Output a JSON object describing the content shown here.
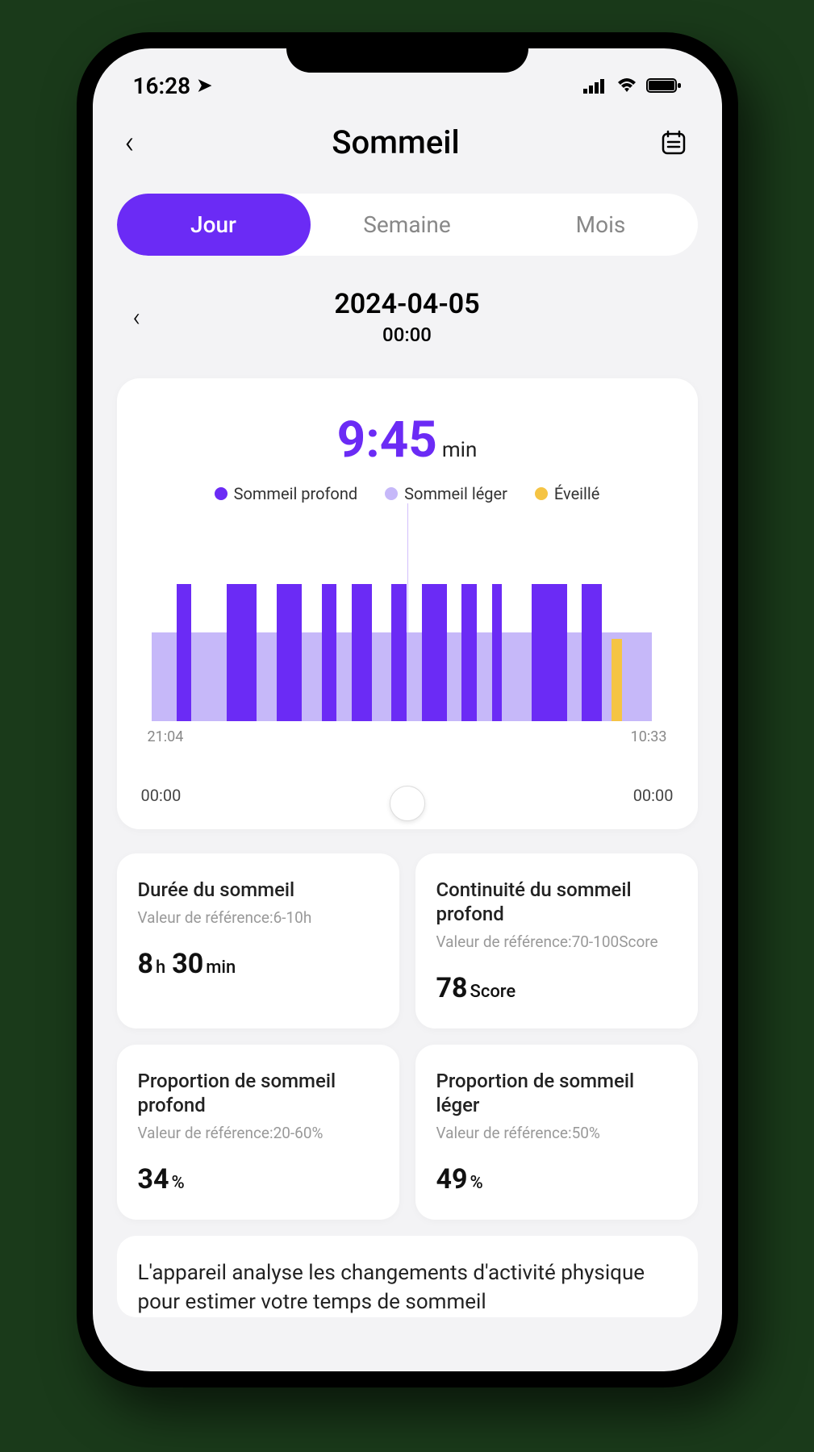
{
  "status": {
    "time": "16:28"
  },
  "header": {
    "title": "Sommeil"
  },
  "tabs": {
    "day": "Jour",
    "week": "Semaine",
    "month": "Mois"
  },
  "date": {
    "value": "2024-04-05",
    "sub": "00:00"
  },
  "summary": {
    "value": "9:45",
    "unit": "min"
  },
  "legend": {
    "deep": "Sommeil profond",
    "light": "Sommeil léger",
    "wake": "Éveillé"
  },
  "chart_data": {
    "type": "bar",
    "x_start": "21:04",
    "x_end": "10:33",
    "background_series": "Sommeil léger",
    "series": [
      {
        "name": "Sommeil profond",
        "color": "#6b2bf5",
        "segments": [
          {
            "start_pct": 5,
            "width_pct": 3,
            "height_pct": 100
          },
          {
            "start_pct": 15,
            "width_pct": 6,
            "height_pct": 100
          },
          {
            "start_pct": 25,
            "width_pct": 5,
            "height_pct": 100
          },
          {
            "start_pct": 34,
            "width_pct": 3,
            "height_pct": 100
          },
          {
            "start_pct": 40,
            "width_pct": 4,
            "height_pct": 100
          },
          {
            "start_pct": 48,
            "width_pct": 3,
            "height_pct": 100
          },
          {
            "start_pct": 54,
            "width_pct": 5,
            "height_pct": 100
          },
          {
            "start_pct": 62,
            "width_pct": 3,
            "height_pct": 100
          },
          {
            "start_pct": 68,
            "width_pct": 2,
            "height_pct": 100
          },
          {
            "start_pct": 76,
            "width_pct": 7,
            "height_pct": 100
          },
          {
            "start_pct": 86,
            "width_pct": 4,
            "height_pct": 100
          }
        ]
      },
      {
        "name": "Éveillé",
        "color": "#f5c444",
        "segments": [
          {
            "start_pct": 92,
            "width_pct": 2,
            "height_pct": 60
          }
        ]
      }
    ]
  },
  "scrub": {
    "start": "00:00",
    "end": "00:00"
  },
  "metrics": [
    {
      "title": "Durée du sommeil",
      "ref": "Valeur de référence:6-10h",
      "v1": "8",
      "u1": "h",
      "v2": "30",
      "u2": "min"
    },
    {
      "title": "Continuité du sommeil profond",
      "ref": "Valeur de référence:70-100Score",
      "v1": "78",
      "u1": "Score"
    },
    {
      "title": "Proportion de sommeil profond",
      "ref": "Valeur de référence:20-60%",
      "v1": "34",
      "u1": "%"
    },
    {
      "title": "Proportion de sommeil léger",
      "ref": "Valeur de référence:50%",
      "v1": "49",
      "u1": "%"
    }
  ],
  "info": "L'appareil analyse les changements d'activité physique pour estimer votre temps de sommeil"
}
